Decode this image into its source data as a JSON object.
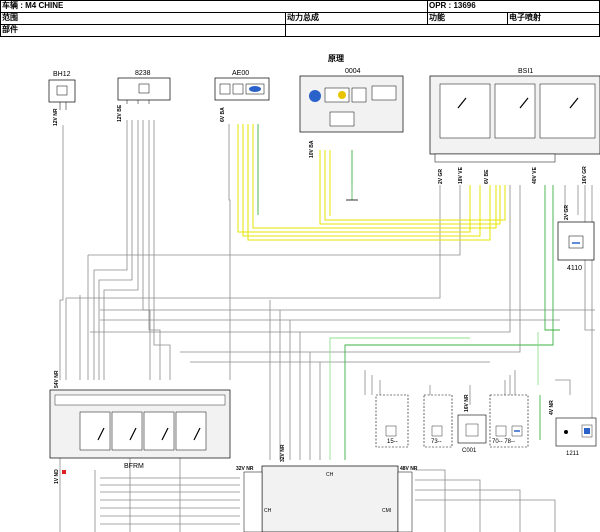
{
  "header": {
    "vehicle": "车辆 : M4 CHINE",
    "opr": "OPR : 13696",
    "scope_label": "范围",
    "powertrain": "动力总成",
    "function_label": "功能",
    "function_value": "电子喷射",
    "part_label": "部件",
    "section_title": "原理"
  },
  "components": {
    "bh12": "BH12",
    "c8238": "8238",
    "ae00": "AE00",
    "c0004": "0004",
    "bsi1": "BSI1",
    "c4110": "4110",
    "bfrm": "BFRM",
    "c15": "15--",
    "c73": "73--",
    "c001": "C001",
    "c70_78": "70-- 78--",
    "c1211": "1211",
    "ch": "CH",
    "cmi": "CMI"
  },
  "connectors": {
    "bh12": "12V NR",
    "c8238": "12V BE",
    "ae00": "6V BA",
    "c0004": "10V BA",
    "bsi1_left": "2V GR",
    "bsi1_mid": "18V VE",
    "bsi1_a": "6V BE",
    "bsi1_b": "40V VE",
    "bsi1_right": "16V GR",
    "c4110": "2V GR",
    "bfrm": "54V NR",
    "c001": "16V NR",
    "c1211": "4V NR",
    "ch_left": "32V NR",
    "ch_top": "32V NR",
    "cmi": "48V NR",
    "bfrm_bottom": "1V ND"
  },
  "wire_colors": {
    "yellow": "#e8e800",
    "green": "#22aa22",
    "light_green": "#7fd87f",
    "gray": "#888888"
  }
}
